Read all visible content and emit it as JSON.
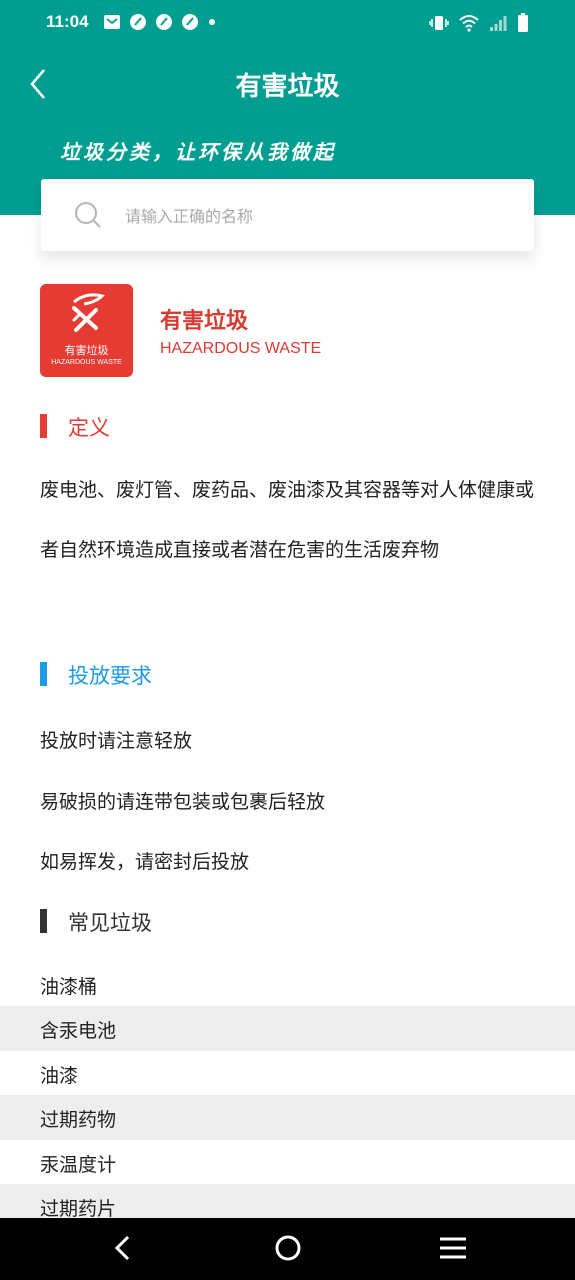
{
  "status_bar": {
    "time": "11:04"
  },
  "header": {
    "title": "有害垃圾",
    "slogan": "垃圾分类，让环保从我做起"
  },
  "search": {
    "placeholder": "请输入正确的名称",
    "value": ""
  },
  "category": {
    "logo_cn": "有害垃圾",
    "logo_en": "HAZARDOUS WASTE",
    "name_cn": "有害垃圾",
    "name_en": "HAZARDOUS WASTE"
  },
  "definition": {
    "title": "定义",
    "text": "废电池、废灯管、废药品、废油漆及其容器等对人体健康或者自然环境造成直接或者潜在危害的生活废弃物"
  },
  "requirements": {
    "title": "投放要求",
    "items": [
      "投放时请注意轻放",
      "易破损的请连带包装或包裹后轻放",
      "如易挥发，请密封后投放"
    ]
  },
  "common": {
    "title": "常见垃圾",
    "items": [
      "油漆桶",
      "含汞电池",
      "油漆",
      "过期药物",
      "汞温度计",
      "过期药片"
    ]
  },
  "colors": {
    "header": "#009e91",
    "hazard_red": "#e53b32",
    "definition_bar": "#e53b32",
    "requirements_blue": "#1d9be6",
    "common_bar": "#333333"
  }
}
